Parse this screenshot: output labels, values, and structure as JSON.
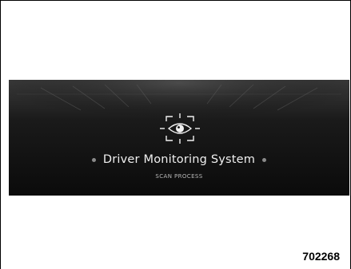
{
  "screen": {
    "icon": "eye-scan-icon",
    "title": "Driver Monitoring System",
    "subtitle": "SCAN PROCESS",
    "accent_color": "#f0f0f0",
    "background_color": "#0b0b0b"
  },
  "figure": {
    "id": "702268"
  }
}
